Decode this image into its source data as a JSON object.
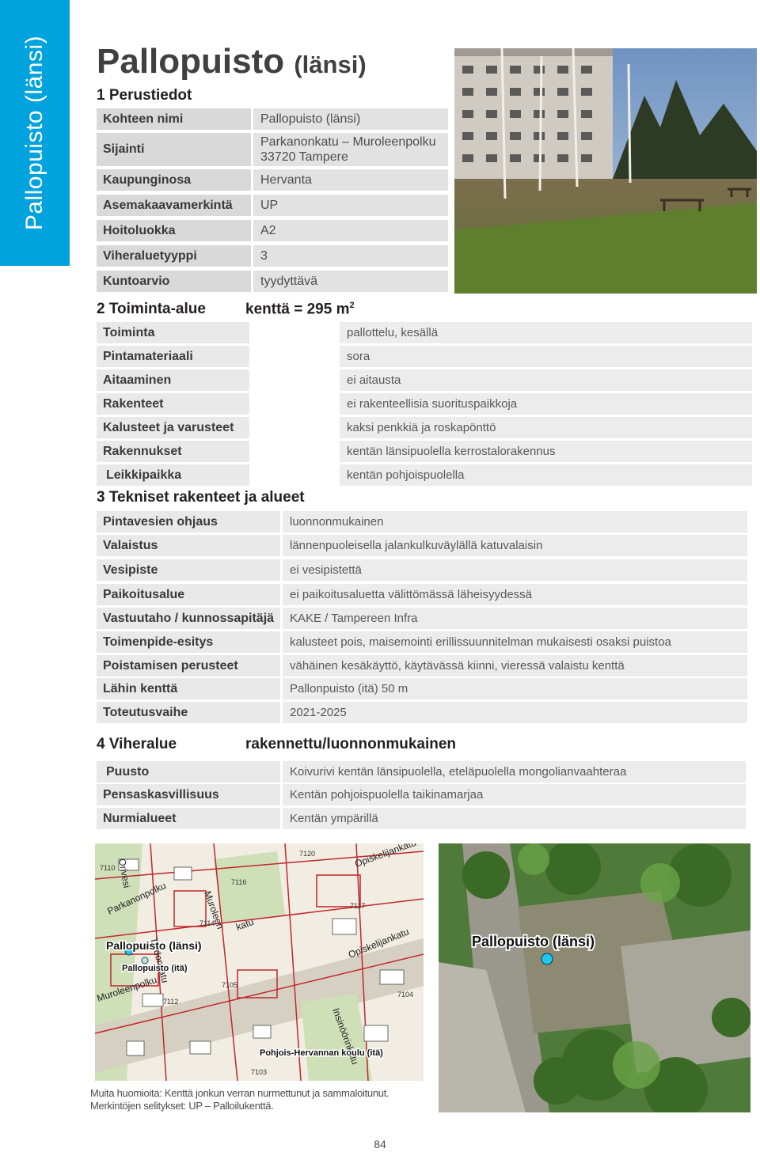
{
  "sidebar_tab": "Pallopuisto (länsi)",
  "title": {
    "main": "Pallopuisto",
    "sub": "(länsi)"
  },
  "basic_info": {
    "heading": "1 Perustiedot",
    "rows": [
      {
        "label": "Kohteen nimi",
        "value": "Pallopuisto (länsi)"
      },
      {
        "label": "Sijainti",
        "value": "Parkanonkatu – Muroleenpolku",
        "value2": "33720 Tampere"
      },
      {
        "label": "Kaupunginosa",
        "value": "Hervanta"
      },
      {
        "label": "Asemakaavamerkintä",
        "value": "UP"
      },
      {
        "label": "Hoitoluokka",
        "value": "A2"
      },
      {
        "label": "Viheraluetyyppi",
        "value": "3"
      },
      {
        "label": "Kuntoarvio",
        "value": "tyydyttävä"
      }
    ]
  },
  "activity": {
    "heading": "2 Toiminta-alue",
    "field_area": "kenttä = 295 m",
    "field_area_sup": "2",
    "rows": [
      {
        "label": "Toiminta",
        "value": "pallottelu, kesällä"
      },
      {
        "label": "Pintamateriaali",
        "value": "sora"
      },
      {
        "label": "Aitaaminen",
        "value": "ei aitausta"
      },
      {
        "label": "Rakenteet",
        "value": "ei rakenteellisia suorituspaikkoja"
      },
      {
        "label": "Kalusteet ja varusteet",
        "value": "kaksi penkkiä ja roskapönttö"
      },
      {
        "label": "Rakennukset",
        "value": "kentän länsipuolella kerrostalorakennus"
      },
      {
        "label": "Leikkipaikka",
        "value": "kentän pohjoispuolella"
      }
    ]
  },
  "technical": {
    "heading": "3 Tekniset rakenteet ja alueet",
    "rows": [
      {
        "label": "Pintavesien ohjaus",
        "value": "luonnonmukainen"
      },
      {
        "label": "Valaistus",
        "value": "lännenpuoleisella jalankulkuväylällä katuvalaisin"
      },
      {
        "label": "Vesipiste",
        "value": "ei vesipistettä"
      },
      {
        "label": "Paikoitusalue",
        "value": "ei paikoitusaluetta välittömässä läheisyydessä"
      },
      {
        "label": "Vastuutaho / kunnossapitäjä",
        "value": "KAKE / Tampereen Infra"
      },
      {
        "label": "Toimenpide-esitys",
        "value": "kalusteet pois, maisemointi erillissuunnitelman mukaisesti osaksi puistoa"
      },
      {
        "label": "Poistamisen perusteet",
        "value": "vähäinen kesäkäyttö, käytävässä kiinni, vieressä valaistu kenttä"
      },
      {
        "label": "Lähin kenttä",
        "value": "Pallonpuisto (itä) 50 m"
      },
      {
        "label": "Toteutusvaihe",
        "value": "2021-2025"
      }
    ]
  },
  "green": {
    "heading": "4 Viheralue",
    "type": "rakennettu/luonnonmukainen",
    "rows": [
      {
        "label": "Puusto",
        "value": "Koivurivi kentän länsipuolella, eteläpuolella mongolianvaahteraa"
      },
      {
        "label": "Pensaskasvillisuus",
        "value": "Kentän pohjoispuolella taikinamarjaa"
      },
      {
        "label": "Nurmialueet",
        "value": "Kentän ympärillä"
      }
    ]
  },
  "map": {
    "label_west": "Pallopuisto (länsi)",
    "label_east": "Pallopuisto (itä)",
    "label_school": "Pohjois-Hervannan koulu (itä)",
    "streets": [
      "Parkanonpolku",
      "Muroleen",
      "katu",
      "Opiskelijankatu",
      "Opiskelijankatu",
      "Muroleenpolku",
      "Insinöörinkatu",
      "Tiedonkatu",
      "Orivesi"
    ],
    "plot_numbers": [
      "7120",
      "7116",
      "7114",
      "7117",
      "7110",
      "7112",
      "7104",
      "7103",
      "7105"
    ],
    "marker_color": "#27c3e8"
  },
  "aerial": {
    "label": "Pallopuisto (länsi)",
    "marker_color": "#1ec7ef"
  },
  "notes": [
    "Muita huomioita: Kenttä jonkun verran nurmettunut ja sammaloitunut.",
    "Merkintöjen selitykset: UP – Palloilukenttä."
  ],
  "page_number": "84",
  "colors": {
    "accent": "#00a3dd",
    "label_bg": "#d9d9da",
    "value_bg": "#e2e2e3"
  }
}
